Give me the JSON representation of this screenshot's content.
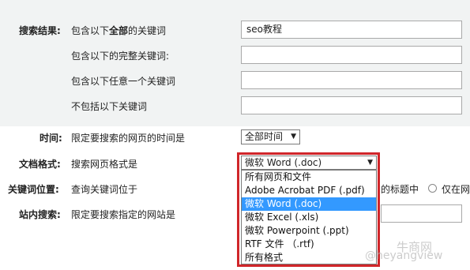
{
  "search_results": {
    "section_label": "搜索结果:",
    "rows": [
      {
        "label_pre": "包含以下",
        "label_bold": "全部",
        "label_post": "的关键词",
        "value": "seo教程"
      },
      {
        "label": "包含以下的完整关键词:",
        "value": ""
      },
      {
        "label": "包含以下任意一个关键词",
        "value": ""
      },
      {
        "label": "不包括以下关键词",
        "value": ""
      }
    ]
  },
  "time": {
    "section_label": "时间:",
    "description": "限定要搜索的网页的时间是",
    "selected": "全部时间"
  },
  "doc_format": {
    "section_label": "文档格式:",
    "description": "搜索网页格式是",
    "selected": "微软 Word (.doc)",
    "options": [
      "所有网页和文件",
      "Adobe Acrobat PDF (.pdf)",
      "微软 Word (.doc)",
      "微软 Excel (.xls)",
      "微软 Powerpoint (.ppt)",
      "RTF 文件 （.rtf)",
      "所有格式"
    ],
    "highlighted_index": 2
  },
  "keyword_position": {
    "section_label": "关键词位置:",
    "description": "查询关键词位于",
    "option_title": "的标题中",
    "option_url": "仅在网"
  },
  "site_search": {
    "section_label": "站内搜索:",
    "description": "限定要搜索指定的网站是",
    "value": ""
  },
  "watermark": {
    "brand": "牛商网",
    "handle": "@heyangview"
  },
  "colors": {
    "top_band": "#f1f3f3",
    "highlight_box": "#d0262a",
    "selected_option": "#3399ff"
  }
}
